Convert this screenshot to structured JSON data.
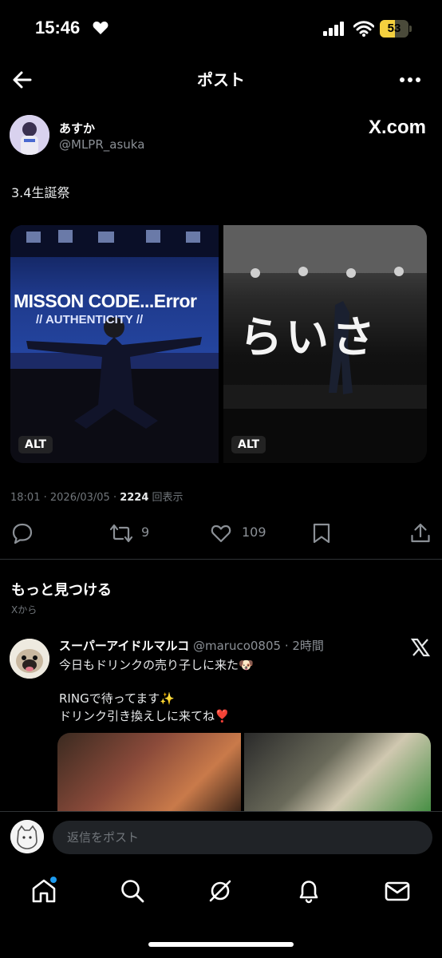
{
  "status_bar": {
    "time": "15:46",
    "battery": "53",
    "battery_level": 0.53
  },
  "header": {
    "title": "ポスト"
  },
  "post": {
    "author_name": "あすか",
    "author_handle": "@MLPR_asuka",
    "source_label": "X.com",
    "text": "3.4生誕祭",
    "media": [
      {
        "banner_text": "MISSON CODE...Error",
        "banner_sub": "// AUTHENTICITY //",
        "alt_label": "ALT"
      },
      {
        "banner_text": "らいさ",
        "alt_label": "ALT"
      }
    ],
    "time": "18:01",
    "date": "2026/03/05",
    "views": "2224",
    "views_label": "回表示",
    "retweets": "9",
    "likes": "109"
  },
  "discover": {
    "title": "もっと見つける",
    "subtitle": "Xから"
  },
  "suggested": {
    "name": "スーパーアイドルマルコ",
    "handle": "@maruco0805",
    "time": "2時間",
    "line1": "今日もドリンクの売り子しに来た🐶",
    "line2": "RINGで待ってます✨",
    "line3": "ドリンク引き換えしに来てね❣️"
  },
  "reply": {
    "placeholder": "返信をポスト"
  },
  "tabs": [
    "home-icon",
    "search-icon",
    "grok-icon",
    "notifications-icon",
    "messages-icon"
  ]
}
